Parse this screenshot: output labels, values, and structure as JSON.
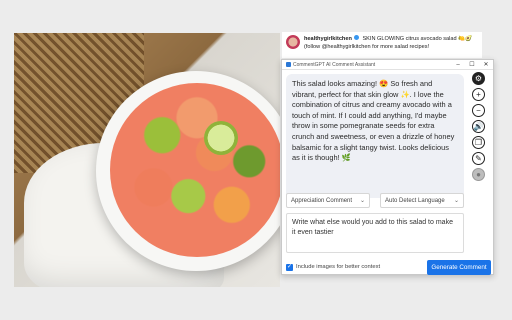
{
  "caption": {
    "username": "healthygirlkitchen",
    "text": "SKIN GLOWING citrus avocado salad 🍋🥑 (follow @healthygirlkitchen for more salad recipes!"
  },
  "window": {
    "title": "CommentGPT AI Comment Assistant",
    "minimize": "–",
    "maximize": "☐",
    "close": "✕"
  },
  "generated_comment": "This salad looks amazing! 😍 So fresh and vibrant, perfect for that skin glow ✨. I love the combination of citrus and creamy avocado with a touch of mint. If I could add anything, I'd maybe throw in some pomegranate seeds for extra crunch and sweetness, or even a drizzle of honey balsamic for a slight tangy twist. Looks delicious as it is though! 🌿",
  "comment_type": {
    "selected": "Appreciation Comment"
  },
  "language": {
    "selected": "Auto Detect Language"
  },
  "prompt": {
    "value": "Write what else would you add to this salad to make it even tastier"
  },
  "include_images": {
    "label": "Include images for better context",
    "checked": true,
    "check_glyph": "✓"
  },
  "generate_button": {
    "label": "Generate Comment"
  },
  "tools": {
    "settings": "⚙",
    "add": "+",
    "remove": "−",
    "sound": "🔊",
    "copy": "❐",
    "edit": "✎",
    "record": "●"
  },
  "colors": {
    "accent": "#1a73e8",
    "comment_bg": "#eef0f5"
  }
}
